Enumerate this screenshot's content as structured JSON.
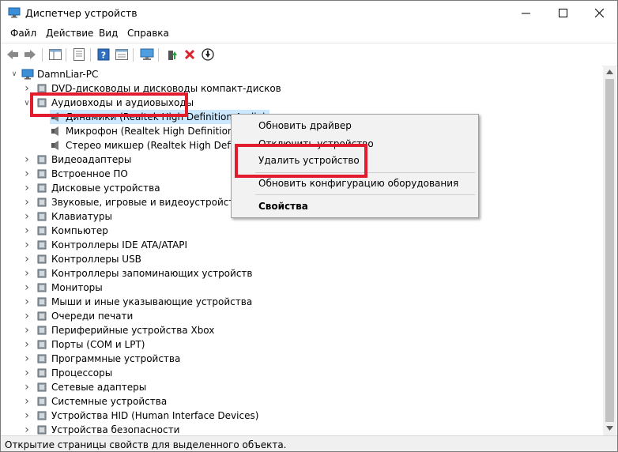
{
  "window": {
    "title": "Диспетчер устройств"
  },
  "menu": [
    "Файл",
    "Действие",
    "Вид",
    "Справка"
  ],
  "tree": {
    "root": "DamnLiar-PC",
    "categories": [
      {
        "label": "DVD-дисководы и дисководы компакт-дисков",
        "icon": "dvd-drive-icon",
        "expander": ">"
      },
      {
        "label": "Аудиовходы и аудиовыходы",
        "icon": "audio-io-icon",
        "expander": "v"
      },
      {
        "label": "Видеоадаптеры",
        "icon": "display-adapter-icon",
        "expander": ">"
      },
      {
        "label": "Встроенное ПО",
        "icon": "firmware-icon",
        "expander": ">"
      },
      {
        "label": "Дисковые устройства",
        "icon": "disk-drive-icon",
        "expander": ">"
      },
      {
        "label": "Звуковые, игровые и видеоустройства",
        "icon": "sound-device-icon",
        "expander": ">"
      },
      {
        "label": "Клавиатуры",
        "icon": "keyboard-icon",
        "expander": ">"
      },
      {
        "label": "Компьютер",
        "icon": "computer-icon",
        "expander": ">"
      },
      {
        "label": "Контроллеры IDE ATA/ATAPI",
        "icon": "ide-controller-icon",
        "expander": ">"
      },
      {
        "label": "Контроллеры USB",
        "icon": "usb-controller-icon",
        "expander": ">"
      },
      {
        "label": "Контроллеры запоминающих устройств",
        "icon": "storage-controller-icon",
        "expander": ">"
      },
      {
        "label": "Мониторы",
        "icon": "monitor-icon",
        "expander": ">"
      },
      {
        "label": "Мыши и иные указывающие устройства",
        "icon": "mouse-icon",
        "expander": ">"
      },
      {
        "label": "Очереди печати",
        "icon": "print-queue-icon",
        "expander": ">"
      },
      {
        "label": "Периферийные устройства Xbox",
        "icon": "xbox-peripheral-icon",
        "expander": ">"
      },
      {
        "label": "Порты (COM и LPT)",
        "icon": "port-icon",
        "expander": ">"
      },
      {
        "label": "Программные устройства",
        "icon": "software-device-icon",
        "expander": ">"
      },
      {
        "label": "Процессоры",
        "icon": "processor-icon",
        "expander": ">"
      },
      {
        "label": "Сетевые адаптеры",
        "icon": "network-adapter-icon",
        "expander": ">"
      },
      {
        "label": "Системные устройства",
        "icon": "system-device-icon",
        "expander": ">"
      },
      {
        "label": "Устройства HID (Human Interface Devices)",
        "icon": "hid-device-icon",
        "expander": ">"
      },
      {
        "label": "Устройства безопасности",
        "icon": "security-device-icon",
        "expander": ">"
      }
    ],
    "audio_children": [
      "Динамики (Realtek High Definition Audio)",
      "Микрофон (Realtek High Definition Audio)",
      "Стерео микшер (Realtek High Definition Audio)"
    ]
  },
  "context_menu": {
    "items": [
      "Обновить драйвер",
      "Отключить устройство",
      "Удалить устройство",
      "Обновить конфигурацию оборудования",
      "Свойства"
    ]
  },
  "status": "Открытие страницы свойств для выделенного объекта.",
  "colors": {
    "highlight": "#e21b2d",
    "selection": "#cce8ff",
    "context_bg": "#f2f2f2"
  }
}
